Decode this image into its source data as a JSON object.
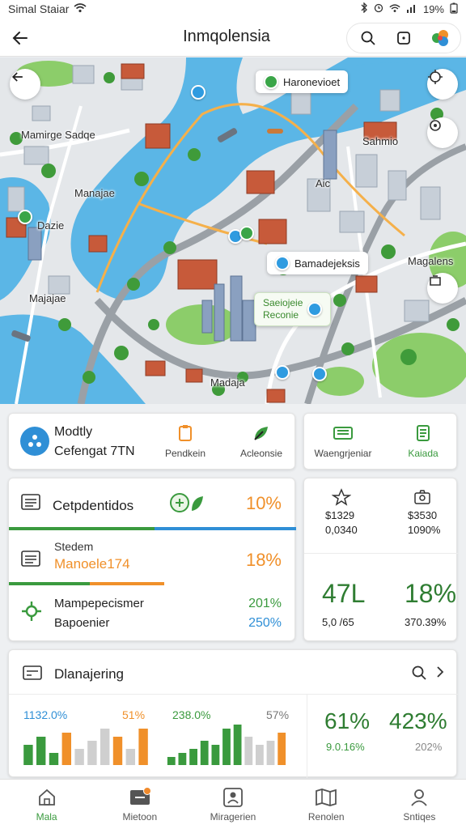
{
  "status_bar": {
    "carrier": "Simal Staiar",
    "battery": "19%",
    "icons": [
      "wifi-icon",
      "bluetooth-icon",
      "signal-icon",
      "battery-icon"
    ]
  },
  "app_bar": {
    "title": "Inmqolensia",
    "actions": [
      "search-icon",
      "square-icon",
      "brand-logo-icon"
    ]
  },
  "map": {
    "labels": {
      "district_nw": "Mamirge Sadqe",
      "district_w": "Manajae",
      "district_w2": "Dazie",
      "district_sw": "Majajae",
      "district_s": "Madaja",
      "district_ne": "Sahmio",
      "district_e": "Magalens",
      "district_mid": "Aic"
    },
    "callouts": {
      "top": "Haronevioet",
      "right": "Bamadejeksis",
      "green_line1": "Saeiojeie",
      "green_line2": "Reconie"
    }
  },
  "quick_actions": {
    "left_card": {
      "title": "Modtly",
      "subtitle": "Cefengat 7TN",
      "tile1_label": "Pendkein",
      "tile2_label": "Acleonsie"
    },
    "right_card": {
      "tile1_label": "Waengrjeniar",
      "tile2_label": "Kaiada"
    }
  },
  "stats": {
    "row1": {
      "title": "Cetpdentidos",
      "value": "10%"
    },
    "row2": {
      "title": "Stedem",
      "subtitle": "Manoele174",
      "value": "18%"
    },
    "row3": {
      "title": "Mampepecismer",
      "subtitle": "Bapoenier",
      "value_top": "201%",
      "value_bottom": "250%"
    }
  },
  "stats_side": {
    "col1_line1": "$1329",
    "col1_line2": "0,0340",
    "col2_line1": "$3530",
    "col2_line2": "1090%",
    "big1": "47L",
    "big2": "18%",
    "small1": "5,0 /65",
    "small2": "370.39%"
  },
  "chart_section": {
    "title": "Dlanajering",
    "left_value": "1132.0%",
    "left_value_right": "51%",
    "mid_value": "238.0%",
    "mid_value_right": "57%",
    "side_big1": "61%",
    "side_big2": "423%",
    "side_small1": "9.0.16%",
    "side_small2": "202%"
  },
  "chart_data": [
    {
      "type": "bar",
      "values": [
        5,
        7,
        3,
        8,
        4,
        6,
        9,
        7,
        4,
        9
      ],
      "colors": [
        "green",
        "green",
        "green",
        "orange",
        "gray",
        "gray",
        "gray",
        "orange",
        "gray",
        "orange"
      ],
      "ylim": [
        0,
        10
      ]
    },
    {
      "type": "bar",
      "values": [
        2,
        3,
        4,
        6,
        5,
        9,
        10,
        7,
        5,
        6,
        8
      ],
      "colors": [
        "green",
        "green",
        "green",
        "green",
        "green",
        "green",
        "green",
        "gray",
        "gray",
        "gray",
        "orange"
      ],
      "ylim": [
        0,
        10
      ]
    }
  ],
  "bottom_nav": {
    "items": [
      {
        "label": "Mala",
        "icon": "home-icon"
      },
      {
        "label": "Mietoon",
        "icon": "ticket-icon"
      },
      {
        "label": "Miragerien",
        "icon": "person-card-icon"
      },
      {
        "label": "Renolen",
        "icon": "map-fold-icon"
      },
      {
        "label": "Sntiqes",
        "icon": "profile-icon"
      }
    ]
  },
  "colors": {
    "green": "#3a9a3e",
    "orange": "#f0902a",
    "blue": "#2f8fd6",
    "water": "#5bb6e6",
    "gray_bar": "#cfcfcf"
  }
}
